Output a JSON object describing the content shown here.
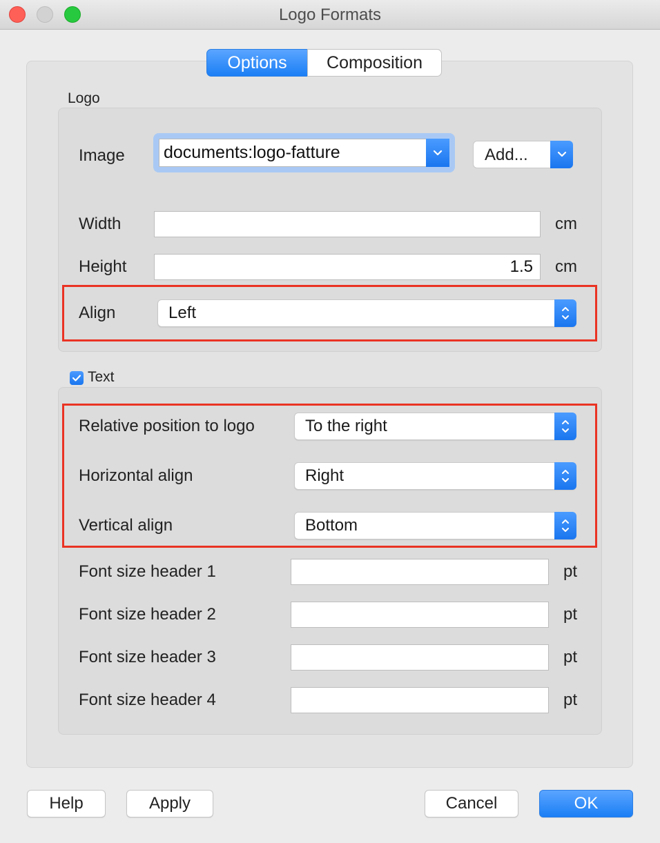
{
  "window": {
    "title": "Logo Formats"
  },
  "tabs": [
    {
      "label": "Options",
      "selected": true
    },
    {
      "label": "Composition",
      "selected": false
    }
  ],
  "logo_section": {
    "label": "Logo",
    "image": {
      "label": "Image",
      "value": "documents:logo-fatture",
      "add_label": "Add..."
    },
    "width": {
      "label": "Width",
      "value": "",
      "unit": "cm"
    },
    "height": {
      "label": "Height",
      "value": "1.5",
      "unit": "cm"
    },
    "align": {
      "label": "Align",
      "value": "Left"
    }
  },
  "text_section": {
    "label": "Text",
    "checked": true,
    "relative_position": {
      "label": "Relative position to logo",
      "value": "To the right"
    },
    "horizontal_align": {
      "label": "Horizontal align",
      "value": "Right"
    },
    "vertical_align": {
      "label": "Vertical align",
      "value": "Bottom"
    },
    "font_sizes": [
      {
        "label": "Font size header 1",
        "value": "",
        "unit": "pt"
      },
      {
        "label": "Font size header 2",
        "value": "",
        "unit": "pt"
      },
      {
        "label": "Font size header 3",
        "value": "",
        "unit": "pt"
      },
      {
        "label": "Font size header 4",
        "value": "",
        "unit": "pt"
      }
    ]
  },
  "buttons": {
    "help": "Help",
    "apply": "Apply",
    "cancel": "Cancel",
    "ok": "OK"
  },
  "colors": {
    "accent": "#1b7ff5",
    "highlight": "#ea3323"
  },
  "icons": [
    "close-icon",
    "minimize-icon",
    "zoom-icon",
    "chevron-down-icon",
    "up-down-chevrons-icon",
    "checkmark-icon"
  ]
}
